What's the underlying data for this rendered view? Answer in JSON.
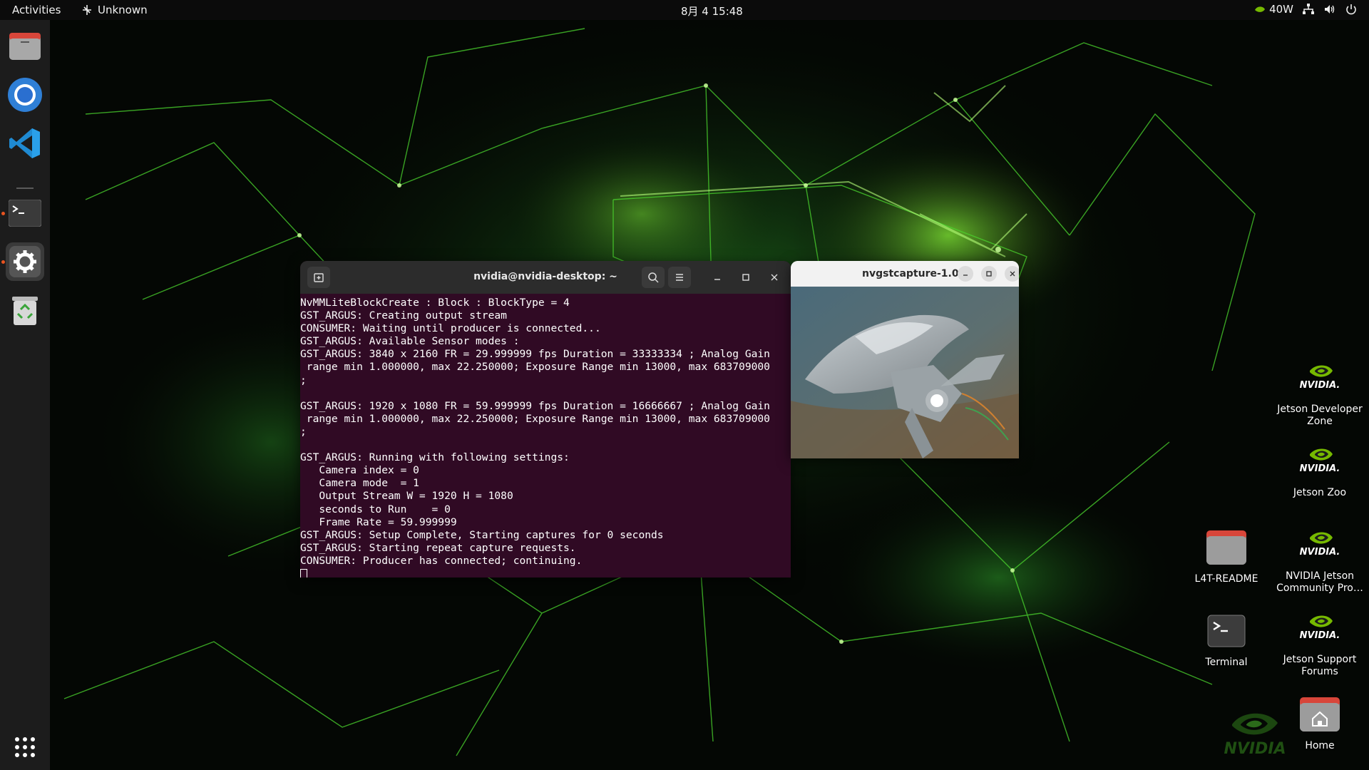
{
  "topbar": {
    "activities": "Activities",
    "app_indicator": "Unknown",
    "clock": "8月 4  15:48",
    "power": "40W"
  },
  "dock": {
    "items": [
      {
        "name": "files",
        "icon": "folder-icon"
      },
      {
        "name": "chromium",
        "icon": "chromium-icon"
      },
      {
        "name": "vscode",
        "icon": "vscode-icon"
      },
      {
        "name": "terminal",
        "icon": "terminal-icon"
      },
      {
        "name": "settings",
        "icon": "gear-icon"
      },
      {
        "name": "trash",
        "icon": "trash-icon"
      }
    ],
    "apps_grid": "apps-grid-icon"
  },
  "terminal": {
    "title": "nvidia@nvidia-desktop: ~",
    "lines": [
      "NvMMLiteBlockCreate : Block : BlockType = 4",
      "GST_ARGUS: Creating output stream",
      "CONSUMER: Waiting until producer is connected...",
      "GST_ARGUS: Available Sensor modes :",
      "GST_ARGUS: 3840 x 2160 FR = 29.999999 fps Duration = 33333334 ; Analog Gain",
      " range min 1.000000, max 22.250000; Exposure Range min 13000, max 683709000",
      ";",
      "",
      "GST_ARGUS: 1920 x 1080 FR = 59.999999 fps Duration = 16666667 ; Analog Gain",
      " range min 1.000000, max 22.250000; Exposure Range min 13000, max 683709000",
      ";",
      "",
      "GST_ARGUS: Running with following settings:",
      "   Camera index = 0",
      "   Camera mode  = 1",
      "   Output Stream W = 1920 H = 1080",
      "   seconds to Run    = 0",
      "   Frame Rate = 59.999999",
      "GST_ARGUS: Setup Complete, Starting captures for 0 seconds",
      "GST_ARGUS: Starting repeat capture requests.",
      "CONSUMER: Producer has connected; continuing."
    ]
  },
  "capture": {
    "title": "nvgstcapture-1.0"
  },
  "desktop": {
    "jetson_dev_zone": "Jetson Developer Zone",
    "jetson_zoo": "Jetson Zoo",
    "l4t_readme": "L4T-README",
    "community_projects": "NVIDIA Jetson Community Pro…",
    "terminal": "Terminal",
    "support_forums": "Jetson Support Forums",
    "home": "Home",
    "nvidia_logo_text": "NVIDIA"
  },
  "colors": {
    "nvidia_green": "#76b900",
    "terminal_bg": "#300a24",
    "accent": "#e95420"
  }
}
